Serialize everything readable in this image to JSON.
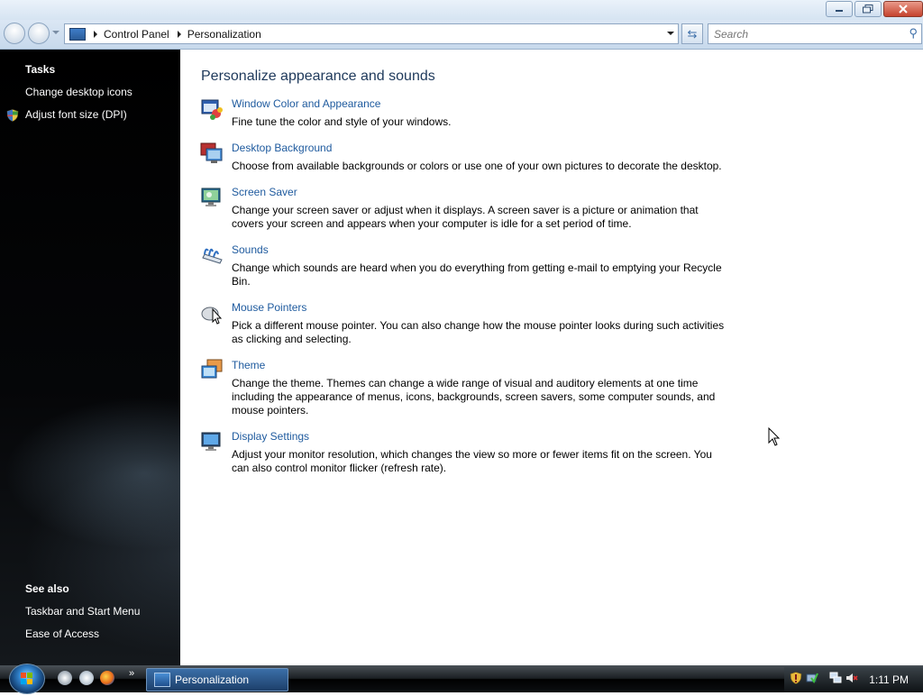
{
  "window": {
    "controls": [
      "minimize",
      "maximize",
      "close"
    ]
  },
  "address_bar": {
    "crumbs": [
      "Control Panel",
      "Personalization"
    ],
    "search_placeholder": "Search"
  },
  "left_pane": {
    "tasks_heading": "Tasks",
    "tasks": [
      "Change desktop icons",
      "Adjust font size (DPI)"
    ],
    "see_also_heading": "See also",
    "see_also": [
      "Taskbar and Start Menu",
      "Ease of Access"
    ]
  },
  "main": {
    "title": "Personalize appearance and sounds",
    "items": [
      {
        "link": "Window Color and Appearance",
        "desc": "Fine tune the color and style of your windows.",
        "icon": "window-color-icon"
      },
      {
        "link": "Desktop Background",
        "desc": "Choose from available backgrounds or colors or use one of your own pictures to decorate the desktop.",
        "icon": "desktop-background-icon"
      },
      {
        "link": "Screen Saver",
        "desc": "Change your screen saver or adjust when it displays. A screen saver is a picture or animation that covers your screen and appears when your computer is idle for a set period of time.",
        "icon": "screen-saver-icon"
      },
      {
        "link": "Sounds",
        "desc": "Change which sounds are heard when you do everything from getting e-mail to emptying your Recycle Bin.",
        "icon": "sounds-icon"
      },
      {
        "link": "Mouse Pointers",
        "desc": "Pick a different mouse pointer. You can also change how the mouse pointer looks during such activities as clicking and selecting.",
        "icon": "mouse-pointers-icon"
      },
      {
        "link": "Theme",
        "desc": "Change the theme. Themes can change a wide range of visual and auditory elements at one time including the appearance of menus, icons, backgrounds, screen savers, some computer sounds, and mouse pointers.",
        "icon": "theme-icon"
      },
      {
        "link": "Display Settings",
        "desc": "Adjust your monitor resolution, which changes the view so more or fewer items fit on the screen. You can also control monitor flicker (refresh rate).",
        "icon": "display-settings-icon"
      }
    ]
  },
  "taskbar": {
    "quicklaunch_overflow": "»",
    "active_window": "Personalization",
    "clock": "1:11 PM"
  }
}
